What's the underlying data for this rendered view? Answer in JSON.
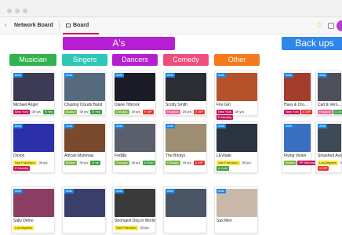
{
  "nav": {
    "back_glyph": "‹",
    "breadcrumb": "Network Board",
    "tab": "Board",
    "star_glyph": "☆"
  },
  "groups": [
    {
      "label": "A's",
      "color": "#b51fd1"
    },
    {
      "label": "Back ups",
      "color": "#2f86e8"
    }
  ],
  "columns": [
    {
      "label": "Musician",
      "color": "#2fb24f"
    },
    {
      "label": "Singers",
      "color": "#2cc7b5"
    },
    {
      "label": "Dancers",
      "color": "#b51fd1"
    },
    {
      "label": "Comedy",
      "color": "#ef4d7b"
    },
    {
      "label": "Other",
      "color": "#f5781a"
    }
  ],
  "acts_badge": "Acts",
  "cards": [
    {
      "name": "Michael Angel",
      "img": "#3b3b55",
      "tags": [
        [
          "New York",
          "#c2185b"
        ],
        [
          "39 yrs",
          "plain"
        ],
        [
          "R Yes",
          "#43a047"
        ]
      ]
    },
    {
      "name": "Chasing Clouds Band",
      "img": "#556a7d",
      "tags": [
        [
          "Boston",
          "#7cb342"
        ],
        [
          "39 yrs",
          "plain"
        ],
        [
          "R Yes",
          "#43a047"
        ]
      ]
    },
    {
      "name": "Diane Tilbrook",
      "img": "#1c1c28",
      "tags": [
        [
          "Chicago",
          "#7cb342"
        ],
        [
          "39 yrs",
          "plain"
        ],
        [
          "Y VIP",
          "#e53935"
        ]
      ]
    },
    {
      "name": "Scotty Smith",
      "img": "#2a2d33",
      "tags": [
        [
          "Houston",
          "#f06292"
        ],
        [
          "39 yrs",
          "plain"
        ],
        [
          "X VIP",
          "#e53935"
        ]
      ]
    },
    {
      "name": "Fire Girl",
      "img": "#b4532a",
      "tags": [
        [
          "New York",
          "#c2185b"
        ],
        [
          "39 yrs",
          "plain"
        ],
        [
          "R Novelty",
          "#c2185b"
        ]
      ]
    },
    {
      "name": "Huey & Dro...",
      "img": "#a33c2b",
      "tags": [
        [
          "New York",
          "#c2185b"
        ],
        [
          "X VIP",
          "#e53935"
        ]
      ]
    },
    {
      "name": "Carl & Vero...",
      "img": "#4f4f5a",
      "tags": [
        [
          "Houston",
          "#f06292"
        ],
        [
          "G ok",
          "#43a047"
        ]
      ]
    },
    {
      "name": "Drixon",
      "img": "#2b2fa8",
      "tags": [
        [
          "San Francisco",
          "#ffeb3b"
        ],
        [
          "39 yrs",
          "plain"
        ],
        [
          "R Novelty",
          "#c2185b"
        ]
      ]
    },
    {
      "name": "African Mummas",
      "img": "#7b4a2e",
      "tags": [
        [
          "Boston",
          "#7cb342"
        ],
        [
          "39 yrs",
          "plain"
        ],
        [
          "G ok",
          "#43a047"
        ]
      ]
    },
    {
      "name": "Fre$$y",
      "img": "#5b5f6b",
      "tags": [
        [
          "Chicago",
          "#7cb342"
        ],
        [
          "39 yrs",
          "plain"
        ],
        [
          "A Gold",
          "#43a047"
        ]
      ]
    },
    {
      "name": "The Bootyz.",
      "img": "#9d8d72",
      "tags": [
        [
          "Chicago",
          "#7cb342"
        ],
        [
          "39 yrs",
          "plain"
        ],
        [
          "X VIP",
          "#e53935"
        ]
      ]
    },
    {
      "name": "LEVitate",
      "img": "#2b3440",
      "tags": [
        [
          "San Francisco",
          "#ffeb3b"
        ],
        [
          "39 yrs",
          "plain"
        ],
        [
          "A Gold",
          "#43a047"
        ]
      ]
    },
    {
      "name": "Flying Vision",
      "img": "#3a6fbf",
      "tags": [
        [
          "Boston",
          "#7cb342"
        ],
        [
          "PP Internati...",
          "#c2185b"
        ]
      ]
    },
    {
      "name": "Smashed Avo",
      "img": "#3e4b57",
      "tags": [
        [
          "Los Angeles",
          "#ffeb3b"
        ],
        [
          "39 yrs",
          "plain"
        ],
        [
          "X VIP",
          "#e53935"
        ]
      ]
    },
    {
      "name": "Sally Demo",
      "img": "#8a3e63",
      "tags": [
        [
          "Los Angeles",
          "#ffeb3b"
        ]
      ]
    },
    {
      "name": "",
      "img": "#3a3f6a",
      "tags": []
    },
    {
      "name": "Strongest Dog in World",
      "img": "#3a3a3a",
      "tags": [
        [
          "San Francisco",
          "#ffeb3b"
        ],
        [
          "39 yrs",
          "plain"
        ]
      ]
    },
    {
      "name": "",
      "img": "#4a5566",
      "tags": []
    },
    {
      "name": "Sax Men",
      "img": "#c9b7a8",
      "tags": []
    }
  ]
}
